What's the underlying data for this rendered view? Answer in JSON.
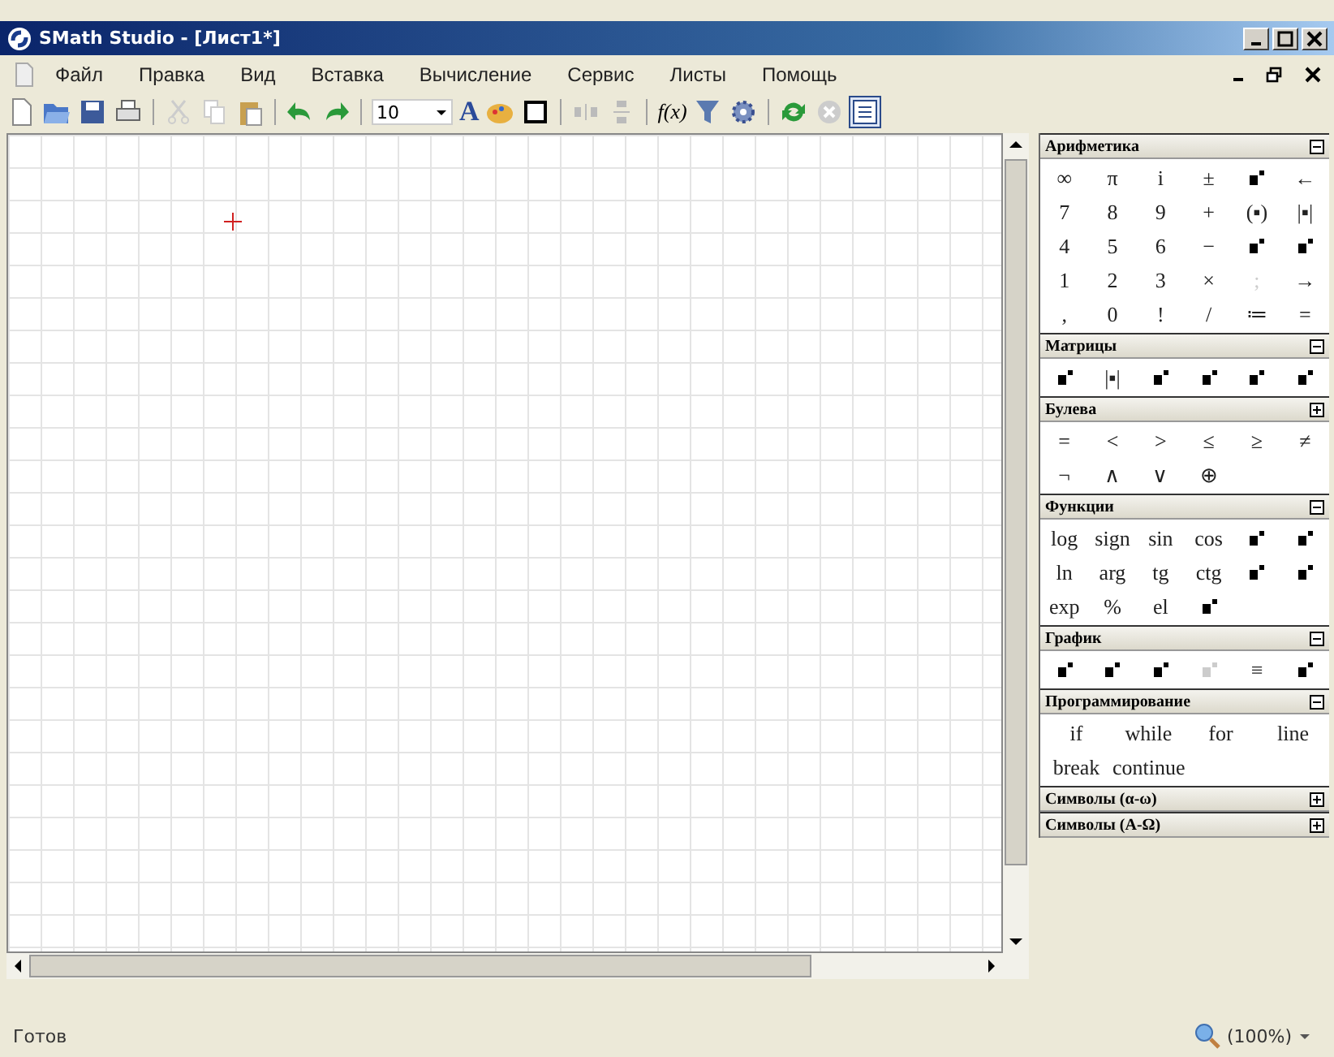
{
  "window": {
    "title": "SMath Studio - [Лист1*]"
  },
  "menu": [
    "Файл",
    "Правка",
    "Вид",
    "Вставка",
    "Вычисление",
    "Сервис",
    "Листы",
    "Помощь"
  ],
  "toolbar": {
    "font_size": "10",
    "font_button": "A",
    "function_button": "f(x)"
  },
  "panels": [
    {
      "title": "Арифметика",
      "expanded": true,
      "kind": "symbols",
      "buttons": [
        {
          "kind": "text",
          "label": "∞"
        },
        {
          "kind": "text",
          "label": "π"
        },
        {
          "kind": "text",
          "label": "i"
        },
        {
          "kind": "text",
          "label": "±"
        },
        {
          "kind": "icon"
        },
        {
          "kind": "text",
          "label": "←"
        },
        {
          "kind": "text",
          "label": "7"
        },
        {
          "kind": "text",
          "label": "8"
        },
        {
          "kind": "text",
          "label": "9"
        },
        {
          "kind": "text",
          "label": "+"
        },
        {
          "kind": "text",
          "label": "(▪)"
        },
        {
          "kind": "text",
          "label": "|▪|"
        },
        {
          "kind": "text",
          "label": "4"
        },
        {
          "kind": "text",
          "label": "5"
        },
        {
          "kind": "text",
          "label": "6"
        },
        {
          "kind": "text",
          "label": "−"
        },
        {
          "kind": "icon"
        },
        {
          "kind": "icon"
        },
        {
          "kind": "text",
          "label": "1"
        },
        {
          "kind": "text",
          "label": "2"
        },
        {
          "kind": "text",
          "label": "3"
        },
        {
          "kind": "text",
          "label": "×"
        },
        {
          "kind": "text",
          "label": ";",
          "disabled": true
        },
        {
          "kind": "text",
          "label": "→"
        },
        {
          "kind": "text",
          "label": ","
        },
        {
          "kind": "text",
          "label": "0"
        },
        {
          "kind": "text",
          "label": "!"
        },
        {
          "kind": "text",
          "label": "/"
        },
        {
          "kind": "text",
          "label": "≔"
        },
        {
          "kind": "text",
          "label": "="
        }
      ]
    },
    {
      "title": "Матрицы",
      "expanded": true,
      "kind": "symbols",
      "buttons": [
        {
          "kind": "icon"
        },
        {
          "kind": "text",
          "label": "|▪|"
        },
        {
          "kind": "icon"
        },
        {
          "kind": "icon"
        },
        {
          "kind": "icon"
        },
        {
          "kind": "icon"
        }
      ]
    },
    {
      "title": "Булева",
      "expanded": false,
      "kind": "symbols",
      "buttons": [
        {
          "kind": "text",
          "label": "="
        },
        {
          "kind": "text",
          "label": "<"
        },
        {
          "kind": "text",
          "label": ">"
        },
        {
          "kind": "text",
          "label": "≤"
        },
        {
          "kind": "text",
          "label": "≥"
        },
        {
          "kind": "text",
          "label": "≠"
        },
        {
          "kind": "text",
          "label": "¬"
        },
        {
          "kind": "text",
          "label": "∧"
        },
        {
          "kind": "text",
          "label": "∨"
        },
        {
          "kind": "text",
          "label": "⊕"
        }
      ]
    },
    {
      "title": "Функции",
      "expanded": true,
      "kind": "symbols",
      "buttons": [
        {
          "kind": "text",
          "label": "log"
        },
        {
          "kind": "text",
          "label": "sign"
        },
        {
          "kind": "text",
          "label": "sin"
        },
        {
          "kind": "text",
          "label": "cos"
        },
        {
          "kind": "icon"
        },
        {
          "kind": "icon"
        },
        {
          "kind": "text",
          "label": "ln"
        },
        {
          "kind": "text",
          "label": "arg"
        },
        {
          "kind": "text",
          "label": "tg"
        },
        {
          "kind": "text",
          "label": "ctg"
        },
        {
          "kind": "icon"
        },
        {
          "kind": "icon"
        },
        {
          "kind": "text",
          "label": "exp"
        },
        {
          "kind": "text",
          "label": "%"
        },
        {
          "kind": "text",
          "label": "el"
        },
        {
          "kind": "icon"
        }
      ]
    },
    {
      "title": "График",
      "expanded": true,
      "kind": "symbols",
      "buttons": [
        {
          "kind": "icon"
        },
        {
          "kind": "icon"
        },
        {
          "kind": "icon"
        },
        {
          "kind": "icon",
          "disabled": true
        },
        {
          "kind": "text",
          "label": "≡"
        },
        {
          "kind": "icon"
        }
      ]
    },
    {
      "title": "Программирование",
      "expanded": true,
      "kind": "words",
      "buttons": [
        {
          "kind": "text",
          "label": "if"
        },
        {
          "kind": "text",
          "label": "while"
        },
        {
          "kind": "text",
          "label": "for"
        },
        {
          "kind": "text",
          "label": "line"
        },
        {
          "kind": "text",
          "label": "break"
        },
        {
          "kind": "text",
          "label": "continue"
        }
      ]
    },
    {
      "title": "Символы (α-ω)",
      "expanded": false
    },
    {
      "title": "Символы (Α-Ω)",
      "expanded": false
    }
  ],
  "status_bar": {
    "text": "Готов",
    "zoom": "(100%)"
  }
}
